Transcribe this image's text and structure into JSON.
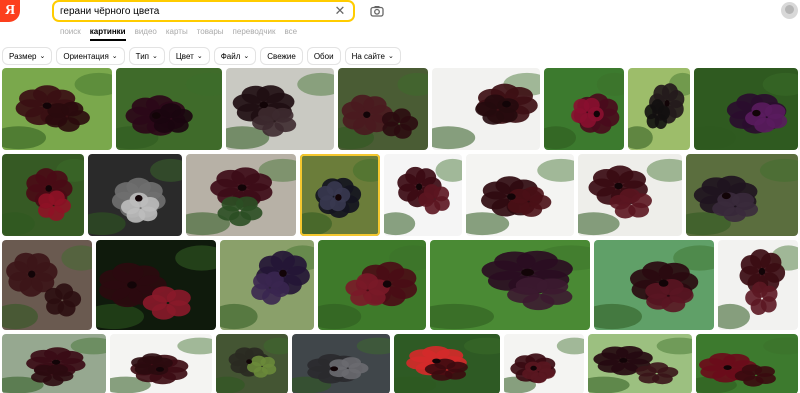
{
  "logo": {
    "letter": "Я"
  },
  "search": {
    "query": "герани чёрного цвета"
  },
  "services": [
    "поиск",
    "картинки",
    "видео",
    "карты",
    "товары",
    "переводчик",
    "все"
  ],
  "active_service": "картинки",
  "filters": [
    {
      "label": "Размер",
      "chevron": true
    },
    {
      "label": "Ориентация",
      "chevron": true
    },
    {
      "label": "Тип",
      "chevron": true
    },
    {
      "label": "Цвет",
      "chevron": true
    },
    {
      "label": "Файл",
      "chevron": true
    },
    {
      "label": "Свежие",
      "chevron": false
    },
    {
      "label": "Обои",
      "chevron": false
    },
    {
      "label": "На сайте",
      "chevron": true
    }
  ],
  "colors": {
    "brand": "#fc3f1d",
    "search_border": "#ffcc00",
    "selected_outline": "#f4c72f"
  },
  "icons": {
    "clear": "close-icon",
    "camera": "camera-icon",
    "avatar": "user-avatar",
    "chevron": "chevron-down-icon"
  },
  "images": [
    {
      "bg": "#7aa84c",
      "petal": "#3a0f14",
      "accent": "#2a0a0d"
    },
    {
      "bg": "#3f6b2a",
      "petal": "#2b0818",
      "accent": "#1b0510"
    },
    {
      "bg": "#c9c9c2",
      "petal": "#1f0e12",
      "accent": "#3d2a2f"
    },
    {
      "bg": "#4a5c34",
      "petal": "#4a1a1f",
      "accent": "#2b0b10"
    },
    {
      "bg": "#f2f2f0",
      "petal": "#3d0f14",
      "accent": "#250a0d"
    },
    {
      "bg": "#3c7a2e",
      "petal": "#4a0b1c",
      "accent": "#8a1030"
    },
    {
      "bg": "#9dbd6a",
      "petal": "#241a1c",
      "accent": "#121010"
    },
    {
      "bg": "#2f5a20",
      "petal": "#2a0d2e",
      "accent": "#5a1c5e"
    },
    {
      "bg": "#365a24",
      "petal": "#4a0b16",
      "accent": "#8f1226"
    },
    {
      "bg": "#2a2a2a",
      "petal": "#6f6f6f",
      "accent": "#bdbdbd"
    },
    {
      "bg": "#b7b1a6",
      "petal": "#3d0c18",
      "accent": "#2b4f24"
    },
    {
      "bg": "#6b7d3a",
      "petal": "#14131f",
      "accent": "#383850"
    },
    {
      "bg": "#f5f5f5",
      "petal": "#3b0a12",
      "accent": "#5c1520"
    },
    {
      "bg": "#f4f4f2",
      "petal": "#2f0a10",
      "accent": "#4a1016"
    },
    {
      "bg": "#eeeeea",
      "petal": "#3a0b12",
      "accent": "#5b1520"
    },
    {
      "bg": "#5b6e3e",
      "petal": "#1f1320",
      "accent": "#3a2a3c"
    },
    {
      "bg": "#6a5a50",
      "petal": "#3c1518",
      "accent": "#2b0d10"
    },
    {
      "bg": "#0f1a0c",
      "petal": "#2b0a0f",
      "accent": "#8a1a2a"
    },
    {
      "bg": "#8aa06a",
      "petal": "#241636",
      "accent": "#3a2650"
    },
    {
      "bg": "#3e7a2a",
      "petal": "#4a0d16",
      "accent": "#7a1a28"
    },
    {
      "bg": "#4a8a34",
      "petal": "#2a0d22",
      "accent": "#3c1a30"
    },
    {
      "bg": "#60a068",
      "petal": "#2a0a10",
      "accent": "#5a1522"
    },
    {
      "bg": "#f2f2f0",
      "petal": "#3b0c12",
      "accent": "#5c1722"
    },
    {
      "bg": "#96a890",
      "petal": "#3a0c16",
      "accent": "#2b0a10"
    },
    {
      "bg": "#f4f4f2",
      "petal": "#3c0c14",
      "accent": "#2a0a0e"
    },
    {
      "bg": "#445533",
      "petal": "#2a2a22",
      "accent": "#6a8a3a"
    },
    {
      "bg": "#40464a",
      "petal": "#2a2a2e",
      "accent": "#6a6a70"
    },
    {
      "bg": "#2e5a24",
      "petal": "#d42a2a",
      "accent": "#3c0a10"
    },
    {
      "bg": "#f4f4f2",
      "petal": "#3a0a12",
      "accent": "#5a1620"
    },
    {
      "bg": "#9cc080",
      "petal": "#250a10",
      "accent": "#3a1418"
    },
    {
      "bg": "#3d7a2e",
      "petal": "#6a0c1a",
      "accent": "#3a0a10"
    }
  ]
}
